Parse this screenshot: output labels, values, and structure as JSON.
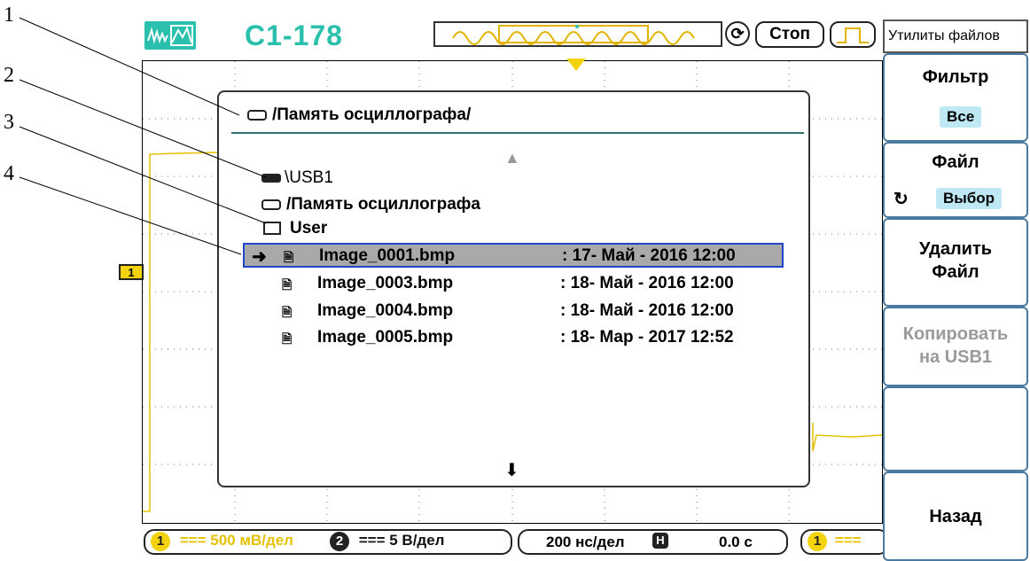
{
  "callouts": [
    "1",
    "2",
    "3",
    "4"
  ],
  "header": {
    "model": "С1-178",
    "run_state": "Стоп"
  },
  "dialog": {
    "title": "/Память осциллографа/",
    "drives": [
      {
        "label": "\\USB1",
        "icon": "usb-drive-icon"
      },
      {
        "label": "/Память осциллографа",
        "icon": "internal-memory-icon"
      },
      {
        "label": "User",
        "icon": "folder-icon"
      }
    ],
    "files": [
      {
        "name": "Image_0001.bmp",
        "date": ":  17- Май - 2016  12:00",
        "selected": true
      },
      {
        "name": "Image_0003.bmp",
        "date": ":  18- Май - 2016  12:00",
        "selected": false
      },
      {
        "name": "Image_0004.bmp",
        "date": ":  18- Май - 2016  12:00",
        "selected": false
      },
      {
        "name": "Image_0005.bmp",
        "date": ":  18- Мар - 2017  12:52",
        "selected": false
      }
    ]
  },
  "status": {
    "ch1_num": "1",
    "ch1_scale": "=== 500 мВ/дел",
    "ch2_num": "2",
    "ch2_scale": "=== 5 В/дел",
    "timebase": "200 нс/дел",
    "h_icon": "H",
    "delay": "0.0 с",
    "trig_ch": "1",
    "trig_coupling": "==="
  },
  "menu": {
    "title": "Утилиты файлов",
    "filter_label": "Фильтр",
    "filter_value": "Все",
    "file_label": "Файл",
    "file_value": "Выбор",
    "delete_label_1": "Удалить",
    "delete_label_2": "Файл",
    "copy_label_1": "Копировать",
    "copy_label_2": "на USB1",
    "back_label": "Назад"
  },
  "colors": {
    "brand": "#2bbfae",
    "ch1": "#f2d30e",
    "ch2": "#1e3c8c",
    "selection": "#a9a9a9",
    "menu_value_bg": "#bde8f4"
  }
}
